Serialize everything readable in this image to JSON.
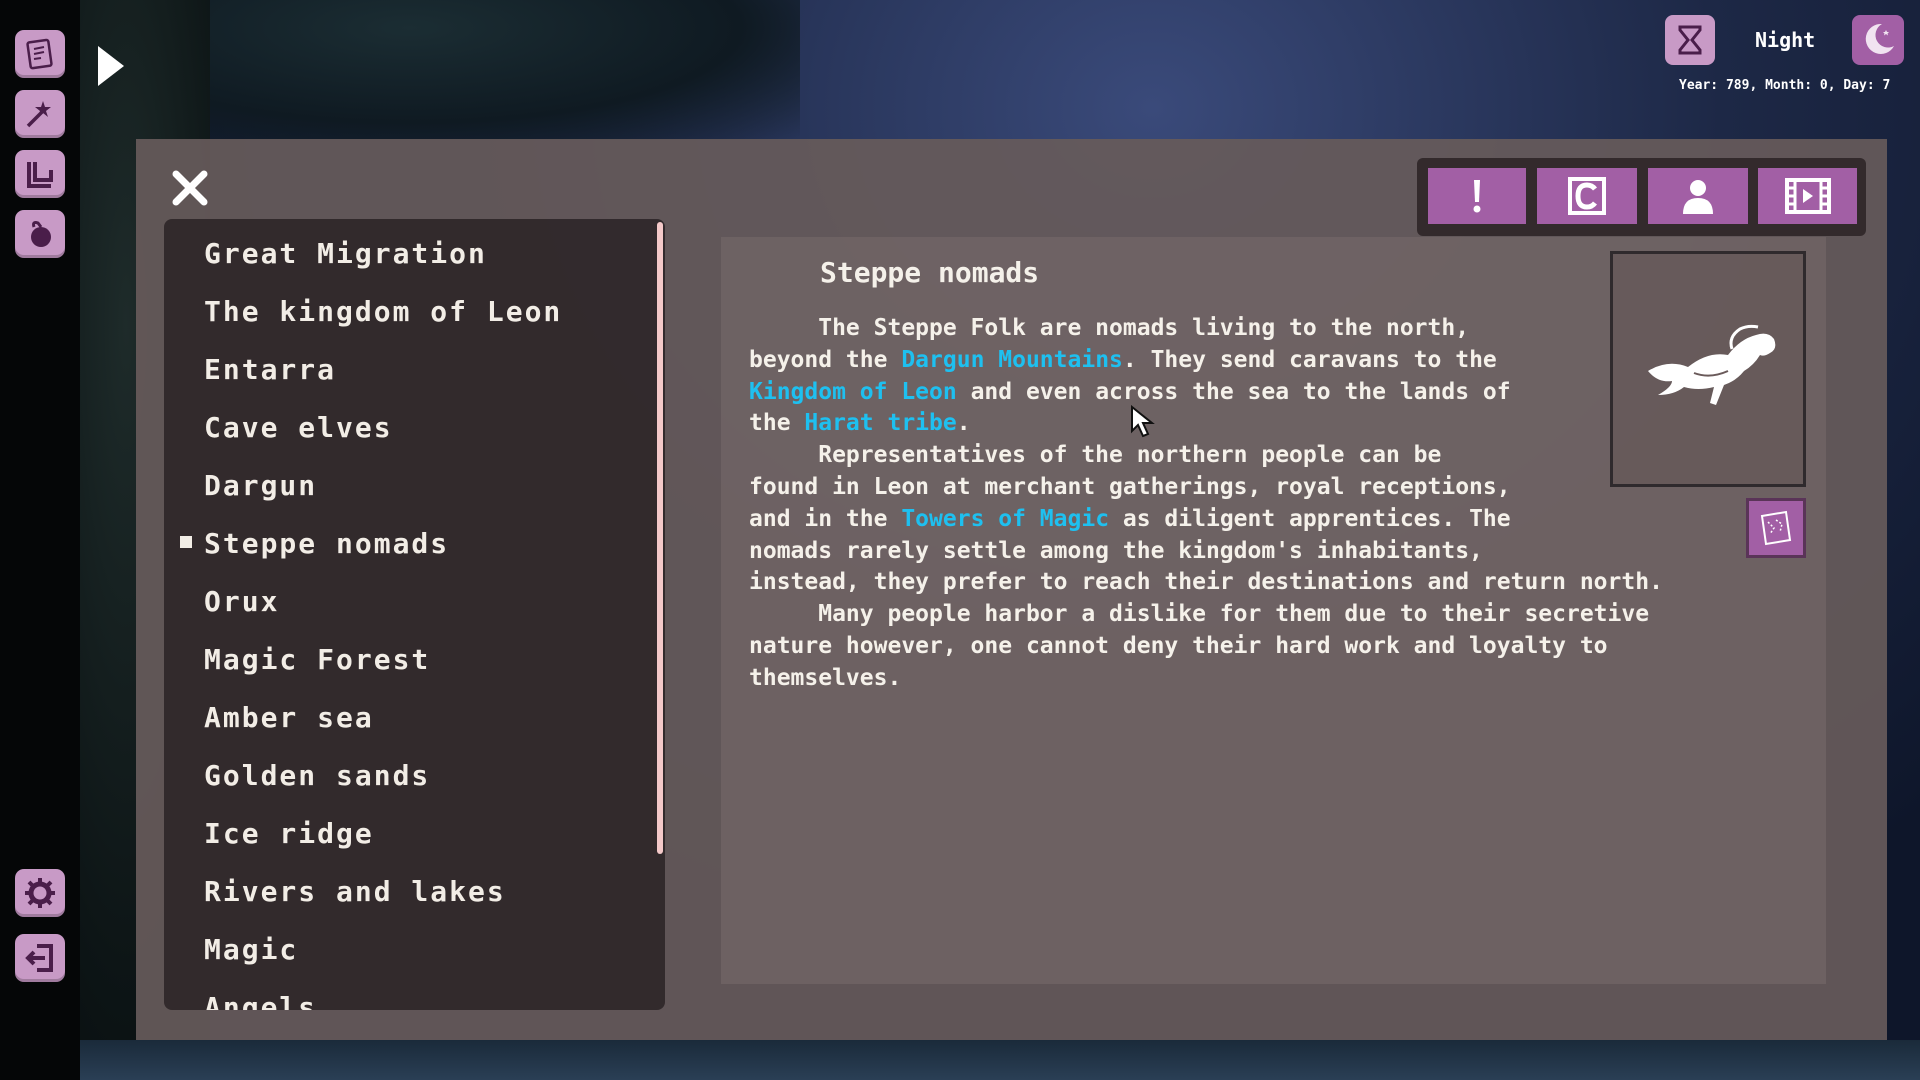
{
  "hud": {
    "period": "Night",
    "date": "Year: 789, Month: 0, Day: 7"
  },
  "sidebar": {
    "tools": [
      {
        "icon": "journal-icon"
      },
      {
        "icon": "spells-icon"
      },
      {
        "icon": "book-icon"
      },
      {
        "icon": "bag-icon"
      }
    ],
    "bottom_tools": [
      {
        "icon": "gear-icon"
      },
      {
        "icon": "exit-icon"
      }
    ]
  },
  "codex": {
    "entries": [
      "Great Migration",
      "The kingdom of Leon",
      "Entarra",
      "Cave elves",
      "Dargun",
      "Steppe nomads",
      "Orux",
      "Magic Forest",
      "Amber sea",
      "Golden sands",
      "Ice ridge",
      "Rivers and lakes",
      "Magic",
      "Angels"
    ],
    "selected_entry": "Steppe nomads",
    "tabs": [
      {
        "icon": "exclamation-icon"
      },
      {
        "icon": "c-icon"
      },
      {
        "icon": "person-icon"
      },
      {
        "icon": "film-icon"
      }
    ],
    "article": {
      "title": "Steppe nomads",
      "p1_a": "     The Steppe Folk are nomads living to the north,\nbeyond the ",
      "link1": "Dargun Mountains",
      "p1_b": ". They send caravans to the\n",
      "link2": "Kingdom of Leon",
      "p1_c": " and even across the sea to the lands of\nthe ",
      "link3": "Harat tribe",
      "p1_d": ".\n     Representatives of the northern people can be\nfound in Leon at merchant gatherings, royal receptions,\nand in the ",
      "link4": "Towers of Magic",
      "p2_b": " as diligent apprentices. The\nnomads rarely settle among the kingdom's inhabitants,\ninstead, they prefer to reach their destinations and return north.\n     Many people harbor a dislike for them due to their secretive\nnature however, one cannot deny their hard work and loyalty to\nthemselves."
    },
    "portrait_icon": "horse-emblem-icon",
    "map_icon": "map-icon"
  },
  "colors": {
    "accent": "#a25fa5",
    "accent_light": "#c89ac6",
    "link": "#1ec0f0",
    "text": "#f5f1ea"
  }
}
